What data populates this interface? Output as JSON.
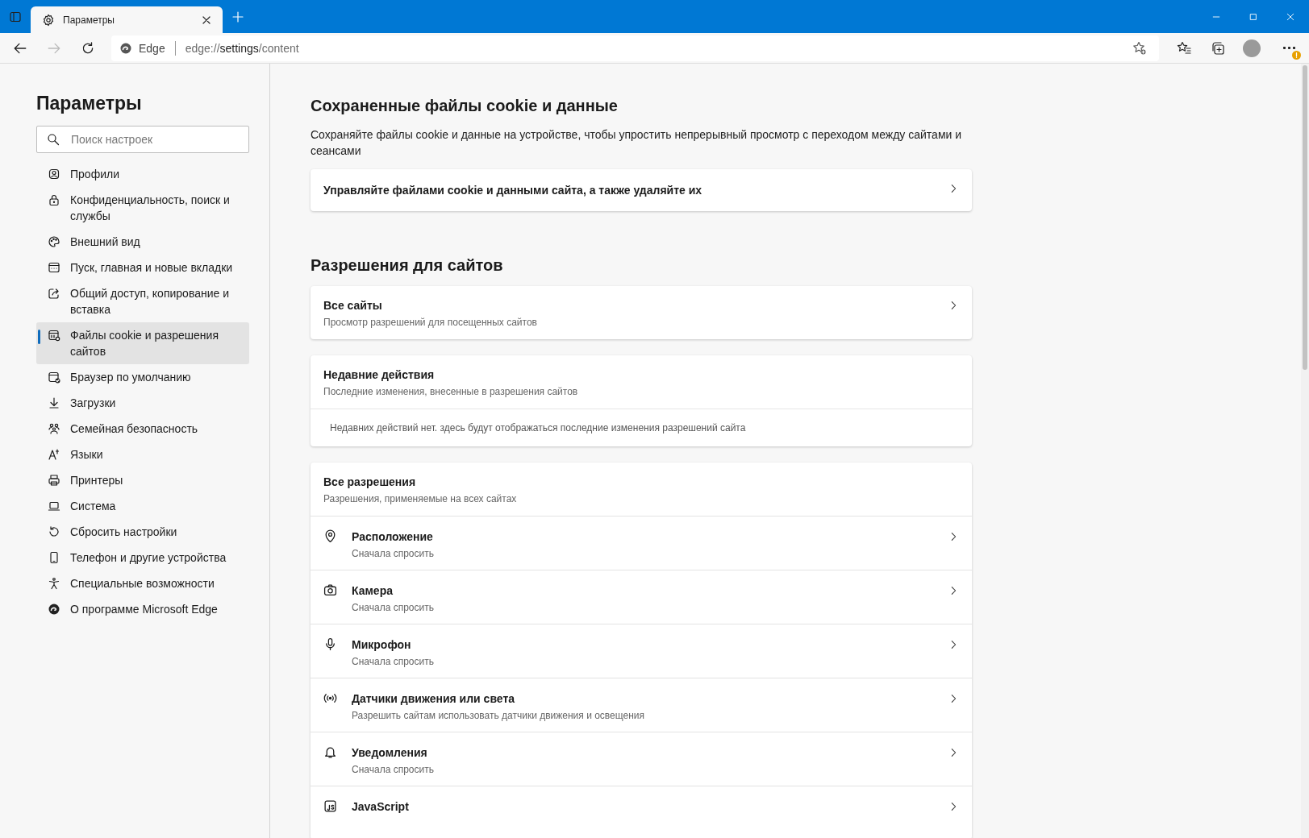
{
  "browser": {
    "tab": {
      "title": "Параметры",
      "selected": true
    },
    "address": {
      "site_label": "Edge",
      "url_scheme": "edge://",
      "url_host": "settings",
      "url_path": "/content"
    }
  },
  "sidebar": {
    "title": "Параметры",
    "search": {
      "placeholder": "Поиск настроек"
    },
    "items": [
      {
        "label": "Профили",
        "selected": false
      },
      {
        "label": "Конфиденциальность, поиск и службы",
        "selected": false
      },
      {
        "label": "Внешний вид",
        "selected": false
      },
      {
        "label": "Пуск, главная и новые вкладки",
        "selected": false
      },
      {
        "label": "Общий доступ, копирование и вставка",
        "selected": false
      },
      {
        "label": "Файлы cookie и разрешения сайтов",
        "selected": true
      },
      {
        "label": "Браузер по умолчанию",
        "selected": false
      },
      {
        "label": "Загрузки",
        "selected": false
      },
      {
        "label": "Семейная безопасность",
        "selected": false
      },
      {
        "label": "Языки",
        "selected": false
      },
      {
        "label": "Принтеры",
        "selected": false
      },
      {
        "label": "Система",
        "selected": false
      },
      {
        "label": "Сбросить настройки",
        "selected": false
      },
      {
        "label": "Телефон и другие устройства",
        "selected": false
      },
      {
        "label": "Специальные возможности",
        "selected": false
      },
      {
        "label": "О программе Microsoft Edge",
        "selected": false
      }
    ]
  },
  "sections": [
    {
      "title": "Сохраненные файлы cookie и данные",
      "description": "Сохраняйте файлы cookie и данные на устройстве, чтобы упростить непрерывный просмотр с переходом между сайтами и сеансами",
      "cards": [
        {
          "kind": "link",
          "title": "Управляйте файлами cookie и данными сайта, а также удаляйте их"
        }
      ]
    },
    {
      "title": "Разрешения для сайтов",
      "cards": [
        {
          "kind": "link",
          "title": "Все сайты",
          "subtitle": "Просмотр разрешений для посещенных сайтов"
        },
        {
          "kind": "info",
          "title": "Недавние действия",
          "subtitle": "Последние изменения, внесенные в разрешения сайтов",
          "note": "Недавних действий нет. здесь будут отображаться последние изменения разрешений сайта"
        },
        {
          "kind": "group",
          "title": "Все разрешения",
          "subtitle": "Разрешения, применяемые на всех сайтах",
          "rows": [
            {
              "title": "Расположение",
              "subtitle": "Сначала спросить"
            },
            {
              "title": "Камера",
              "subtitle": "Сначала спросить"
            },
            {
              "title": "Микрофон",
              "subtitle": "Сначала спросить"
            },
            {
              "title": "Датчики движения или света",
              "subtitle": "Разрешить сайтам использовать датчики движения и освещения"
            },
            {
              "title": "Уведомления",
              "subtitle": "Сначала спросить"
            },
            {
              "title": "JavaScript"
            }
          ]
        }
      ]
    }
  ]
}
